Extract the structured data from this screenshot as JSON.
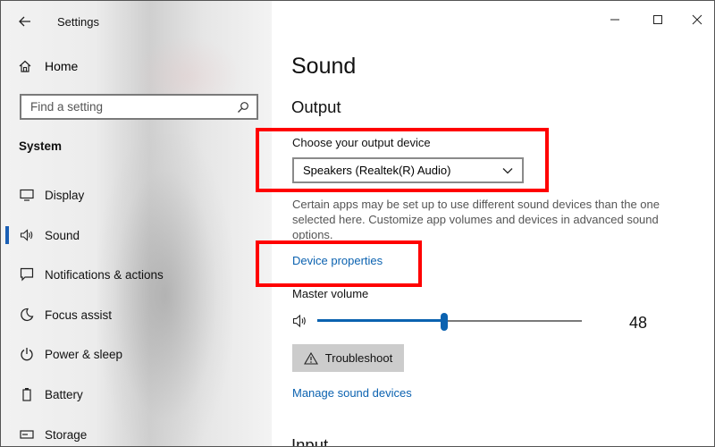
{
  "window": {
    "title": "Settings"
  },
  "sidebar": {
    "home_label": "Home",
    "search_placeholder": "Find a setting",
    "section_title": "System",
    "items": [
      {
        "label": "Display",
        "icon": "monitor-icon"
      },
      {
        "label": "Sound",
        "icon": "speaker-icon",
        "active": true
      },
      {
        "label": "Notifications & actions",
        "icon": "notification-icon"
      },
      {
        "label": "Focus assist",
        "icon": "moon-icon"
      },
      {
        "label": "Power & sleep",
        "icon": "power-icon"
      },
      {
        "label": "Battery",
        "icon": "battery-icon"
      },
      {
        "label": "Storage",
        "icon": "storage-icon"
      }
    ]
  },
  "main": {
    "page_title": "Sound",
    "output_title": "Output",
    "output_device_label": "Choose your output device",
    "output_device_value": "Speakers (Realtek(R) Audio)",
    "description": "Certain apps may be set up to use different sound devices than the one selected here. Customize app volumes and devices in advanced sound options.",
    "device_properties_link": "Device properties",
    "master_volume_label": "Master volume",
    "master_volume_value": "48",
    "master_volume_level": 48,
    "troubleshoot_label": "Troubleshoot",
    "manage_devices_link": "Manage sound devices",
    "next_section_title": "Input"
  },
  "colors": {
    "accent": "#0b62b0",
    "highlight": "#ff0000"
  }
}
